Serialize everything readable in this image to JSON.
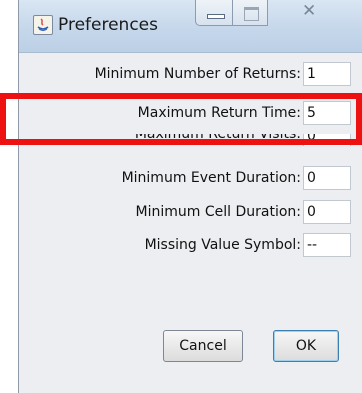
{
  "window": {
    "title": "Preferences",
    "icon": "java-app-icon"
  },
  "fields": [
    {
      "label": "Minimum Number of Returns:",
      "value": "1"
    },
    {
      "label": "Maximum Return Time:",
      "value": "5"
    },
    {
      "label": "Maximum Return Visits:",
      "value": "0"
    },
    {
      "label": "Minimum Event Duration:",
      "value": "0"
    },
    {
      "label": "Minimum Cell Duration:",
      "value": "0"
    },
    {
      "label": "Missing Value Symbol:",
      "value": "--"
    }
  ],
  "buttons": {
    "cancel": "Cancel",
    "ok": "OK"
  },
  "colors": {
    "highlight": "#ee1111",
    "titlebar": "#c4d6ea"
  }
}
